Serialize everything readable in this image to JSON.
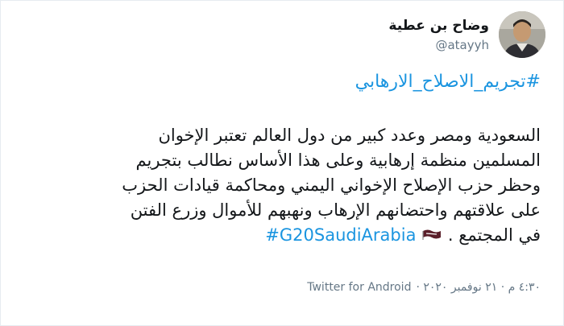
{
  "user": {
    "display_name": "وضاح بن عطية",
    "handle": "@atayyh"
  },
  "tweet": {
    "hashtag_top": "#تجريم_الاصلاح_الارهابي",
    "lines": [
      "السعودية ومصر وعدد كبير من دول العالم تعتبر الإخوان",
      "المسلمين منظمة إرهابية وعلى هذا الأساس نطالب بتجريم",
      "وحظر حزب الإصلاح الإخواني اليمني ومحاكمة قيادات الحزب",
      "على علاقتهم واحتضانهم الإرهاب ونهبهم للأموال وزرع الفتن"
    ],
    "last_line_text": "في المجتمع .",
    "hashtag_inline": "#G20SaudiArabia",
    "flag_icon": "saudi-flag-icon"
  },
  "meta": {
    "time_date": "٤:٣٠ م · ٢١ نوفمبر ٢٠٢٠ ·",
    "source": "Twitter for Android"
  },
  "colors": {
    "link": "#1b95e0",
    "text": "#14171a",
    "secondary": "#657786"
  }
}
